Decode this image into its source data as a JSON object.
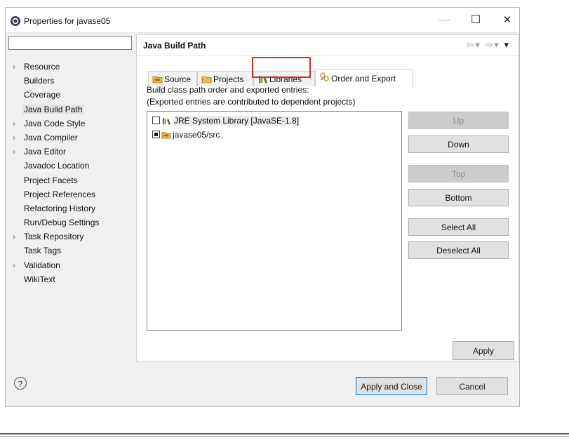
{
  "window": {
    "title": "Properties for javase05",
    "controls": {
      "minimize": "—",
      "maximize": "☐",
      "close": "✕"
    }
  },
  "filter": {
    "value": "",
    "placeholder": ""
  },
  "tree": {
    "items": [
      {
        "label": "Resource",
        "expandable": true
      },
      {
        "label": "Builders",
        "expandable": false
      },
      {
        "label": "Coverage",
        "expandable": false
      },
      {
        "label": "Java Build Path",
        "expandable": false,
        "selected": true
      },
      {
        "label": "Java Code Style",
        "expandable": true
      },
      {
        "label": "Java Compiler",
        "expandable": true
      },
      {
        "label": "Java Editor",
        "expandable": true
      },
      {
        "label": "Javadoc Location",
        "expandable": false
      },
      {
        "label": "Project Facets",
        "expandable": false
      },
      {
        "label": "Project References",
        "expandable": false
      },
      {
        "label": "Refactoring History",
        "expandable": false
      },
      {
        "label": "Run/Debug Settings",
        "expandable": false
      },
      {
        "label": "Task Repository",
        "expandable": true
      },
      {
        "label": "Task Tags",
        "expandable": false
      },
      {
        "label": "Validation",
        "expandable": true
      },
      {
        "label": "WikiText",
        "expandable": false
      }
    ]
  },
  "page": {
    "title": "Java Build Path",
    "tabs": [
      {
        "label": "Source",
        "icon": "source-folder-icon"
      },
      {
        "label": "Projects",
        "icon": "projects-folder-icon"
      },
      {
        "label": "Libraries",
        "icon": "libraries-icon",
        "highlighted": true
      },
      {
        "label": "Order and Export",
        "icon": "order-export-icon",
        "active": true
      }
    ],
    "description_line1": "Build class path order and exported entries:",
    "description_line2": "(Exported entries are contributed to dependent projects)",
    "entries": [
      {
        "label": "JRE System Library [JavaSE-1.8]",
        "checked": false,
        "selected": true,
        "icon": "library-icon"
      },
      {
        "label": "javase05/src",
        "checked": true,
        "selected": false,
        "icon": "source-folder-icon"
      }
    ],
    "buttons": {
      "up": "Up",
      "down": "Down",
      "top": "Top",
      "bottom": "Bottom",
      "select_all": "Select All",
      "deselect_all": "Deselect All"
    },
    "apply": "Apply"
  },
  "footer": {
    "help": "?",
    "apply_close": "Apply and Close",
    "cancel": "Cancel"
  },
  "colors": {
    "highlight": "#d62a2a",
    "primary_border": "#0078d7"
  }
}
